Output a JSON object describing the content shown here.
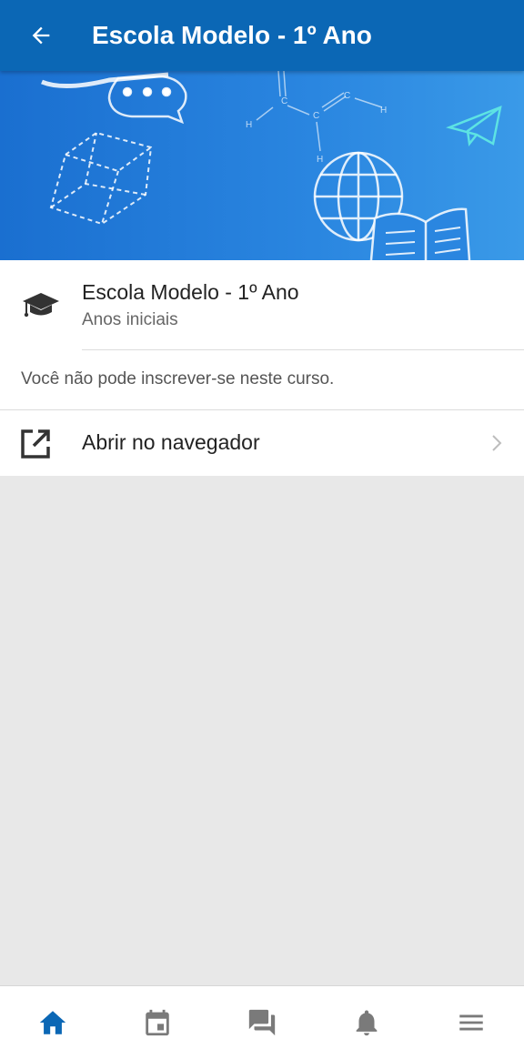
{
  "appbar": {
    "title": "Escola Modelo - 1º Ano",
    "back_icon": "arrow-back-icon"
  },
  "colors": {
    "primary": "#0b67b5",
    "banner": "#2a86e0",
    "active_nav": "#0b67b5",
    "inactive_nav": "#7a7a7a"
  },
  "course": {
    "name": "Escola Modelo - 1º Ano",
    "category": "Anos iniciais",
    "icon": "graduation-cap-icon"
  },
  "notice": "Você não pode inscrever-se neste curso.",
  "open_browser": {
    "label": "Abrir no navegador",
    "icon": "open-in-new-icon"
  },
  "bottom_nav": [
    {
      "name": "home",
      "icon": "home-icon",
      "active": true
    },
    {
      "name": "calendar",
      "icon": "calendar-icon",
      "active": false
    },
    {
      "name": "messages",
      "icon": "chat-icon",
      "active": false
    },
    {
      "name": "notifications",
      "icon": "bell-icon",
      "active": false
    },
    {
      "name": "more",
      "icon": "menu-icon",
      "active": false
    }
  ]
}
